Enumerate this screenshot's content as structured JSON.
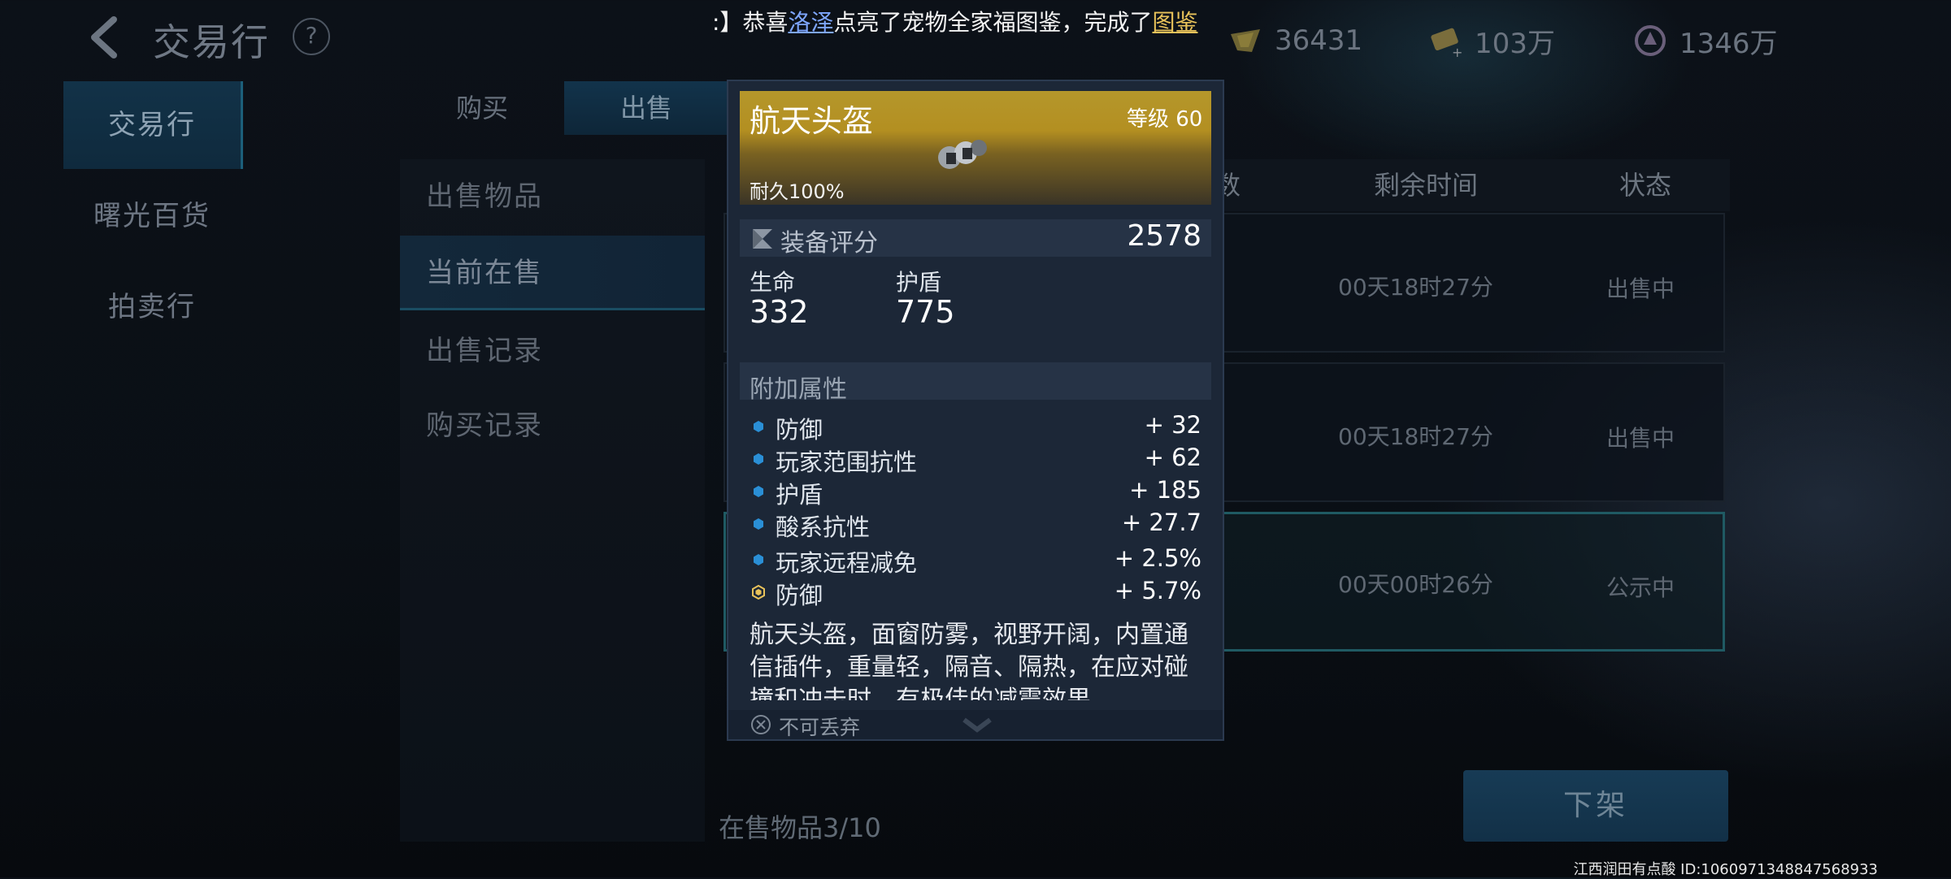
{
  "header": {
    "title": "交易行",
    "help": "?",
    "currencies": [
      {
        "icon": "gold-bar-icon",
        "value": "36431"
      },
      {
        "icon": "coins-plus-icon",
        "value": "103万"
      },
      {
        "icon": "crystal-icon",
        "value": "1346万"
      }
    ]
  },
  "marquee": {
    "prefix": ":】恭喜",
    "player": "洛泽",
    "middle": "点亮了宠物全家福图鉴，完成了",
    "suffix": "图鉴"
  },
  "nav": [
    "交易行",
    "曙光百货",
    "拍卖行"
  ],
  "tabs": [
    "购买",
    "出售"
  ],
  "sub_menu": [
    "出售物品",
    "当前在售",
    "出售记录",
    "购买记录"
  ],
  "list": {
    "col_partial": "数",
    "col_remaining": "剩余时间",
    "col_status": "状态",
    "rows": [
      {
        "time": "00天18时27分",
        "status": "出售中"
      },
      {
        "time": "00天18时27分",
        "status": "出售中"
      },
      {
        "time": "00天00时26分",
        "status": "公示中"
      }
    ],
    "count": "在售物品3/10",
    "delist": "下架"
  },
  "tooltip": {
    "name": "航天头盔",
    "level": "等级 60",
    "durability": "耐久100%",
    "score_label": "装备评分",
    "score": "2578",
    "stats": [
      {
        "label": "生命",
        "value": "332"
      },
      {
        "label": "护盾",
        "value": "775"
      }
    ],
    "extra_title": "附加属性",
    "attributes": [
      {
        "name": "防御",
        "value": "+ 32"
      },
      {
        "name": "玩家范围抗性",
        "value": "+ 62"
      },
      {
        "name": "护盾",
        "value": "+ 185"
      },
      {
        "name": "酸系抗性",
        "value": "+ 27.7"
      },
      {
        "name": "玩家远程减免",
        "value": "+ 2.5%"
      },
      {
        "name": "防御",
        "value": "+ 5.7%"
      }
    ],
    "description": "航天头盔，面窗防雾，视野开阔，内置通信插件，重量轻，隔音、隔热，在应对碰撞和冲击时，有极佳的减震效果。",
    "discard": "不可丢弃"
  },
  "footer": {
    "id": "江西润田有点酸  ID:1060971348847568933"
  },
  "colors": {
    "accent": "#1c5f7a",
    "gold": "#b5972b",
    "attr_dot": "#2a8fd6",
    "attr_dot_special": "#e8c25a"
  }
}
